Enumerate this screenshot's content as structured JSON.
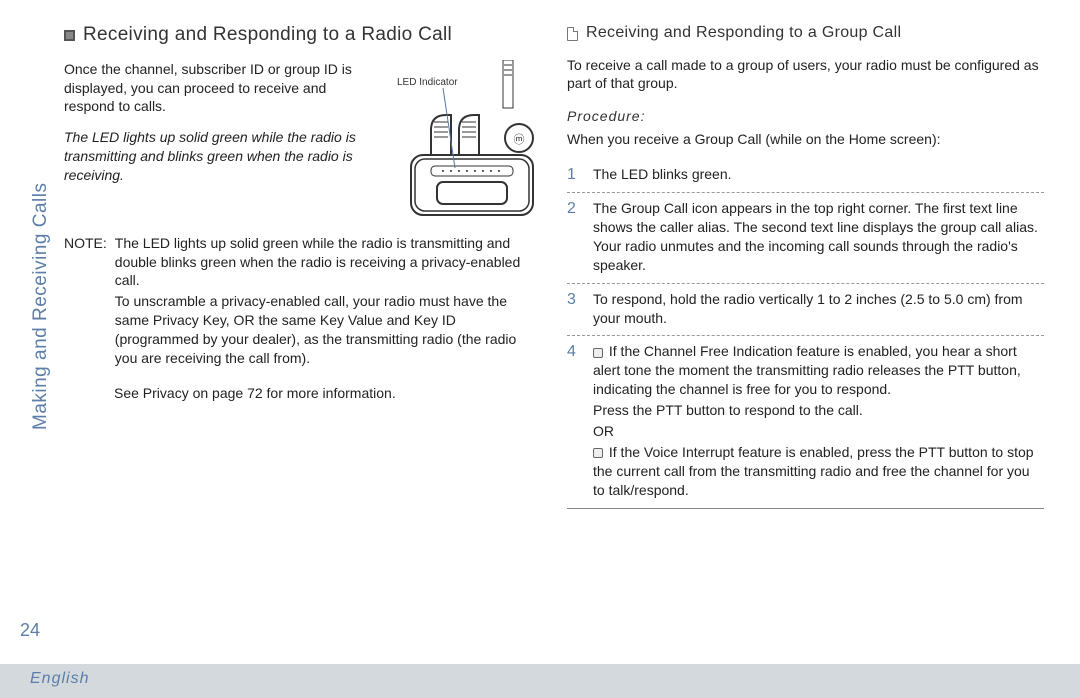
{
  "sidebar": {
    "section_label": "Making and Receiving Calls",
    "page_number": "24",
    "language": "English"
  },
  "left": {
    "heading": "Receiving and Responding to a Radio Call",
    "intro": "Once the channel, subscriber ID or group ID is displayed, you can proceed to receive and respond to calls.",
    "italic_note": "The LED lights up solid green while the radio is transmitting and blinks green when the radio is receiving.",
    "figure_label": "LED Indicator",
    "note_label": "NOTE:",
    "note_p1": "The LED lights up solid green while the radio is transmitting and double blinks green when the radio is receiving a privacy-enabled call.",
    "note_p2": "To unscramble a privacy-enabled call, your radio must have the same Privacy Key, OR the same Key Value and Key ID (programmed by your dealer), as the transmitting radio (the radio you are receiving the call from).",
    "see_ref": "See Privacy  on page 72 for more information."
  },
  "right": {
    "heading": "Receiving and Responding to a Group Call",
    "intro": "To receive a call made to a group of users, your radio must be configured as part of that group.",
    "procedure_label": "Procedure:",
    "procedure_sub": "When you receive a Group Call (while on the Home screen):",
    "steps": {
      "s1": "The LED blinks green.",
      "s2": "The Group Call icon appears in the top right corner. The first text line shows the caller alias. The second text line displays the group call alias. Your radio unmutes and the incoming call sounds through the radio's speaker.",
      "s3": "To respond, hold the radio vertically 1 to 2 inches (2.5 to 5.0 cm) from your mouth.",
      "s4a": "If the Channel Free Indication feature is enabled, you hear a short alert tone the moment the transmitting radio releases the PTT button, indicating the channel is free for you to respond.",
      "s4b": "Press the PTT button to respond to the call.",
      "s4c": "OR",
      "s4d": "If the Voice Interrupt feature is enabled, press the PTT button to stop the current call from the transmitting radio and free the channel for you to talk/respond."
    }
  }
}
